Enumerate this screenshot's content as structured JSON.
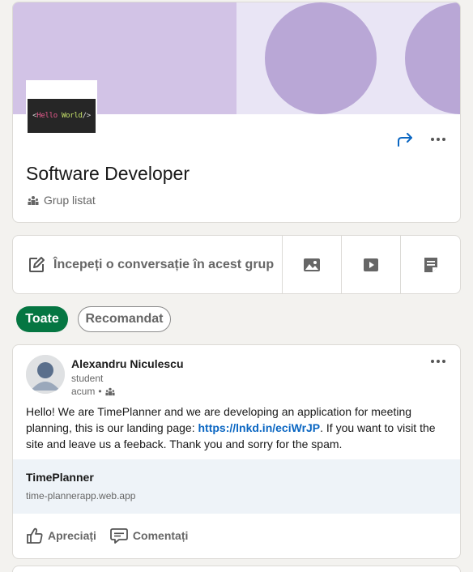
{
  "group": {
    "logo_lt": "<",
    "logo_hello": "Hello",
    "logo_world": "World",
    "logo_close": "/>",
    "title": "Software Developer",
    "type": "Grup listat"
  },
  "composer": {
    "start_label": "Începeți o conversație în acest grup"
  },
  "filters": {
    "all": "Toate",
    "recommended": "Recomandat"
  },
  "post": {
    "author": "Alexandru Niculescu",
    "headline": "student",
    "time": "acum",
    "separator": "•",
    "text_before": "Hello! We are TimePlanner and we are developing an application for meeting planning, this is our landing page: ",
    "link_text": "https://lnkd.in/eciWrJP",
    "text_after": ". If you want to visit the site and leave us a feeback. Thank you and sorry for the spam.",
    "preview_title": "TimePlanner",
    "preview_url": "time-plannerapp.web.app",
    "like_label": "Apreciați",
    "comment_label": "Comentați"
  },
  "colors": {
    "accent_green": "#057642",
    "link_blue": "#0a66c2",
    "cover_light": "#e9e5f5",
    "cover_mid": "#d2c3e6",
    "cover_circle": "#b9a7d6"
  },
  "icons": [
    "share-icon",
    "more-icon",
    "group-icon",
    "edit-icon",
    "image-icon",
    "video-icon",
    "article-icon",
    "like-icon",
    "comment-icon"
  ]
}
